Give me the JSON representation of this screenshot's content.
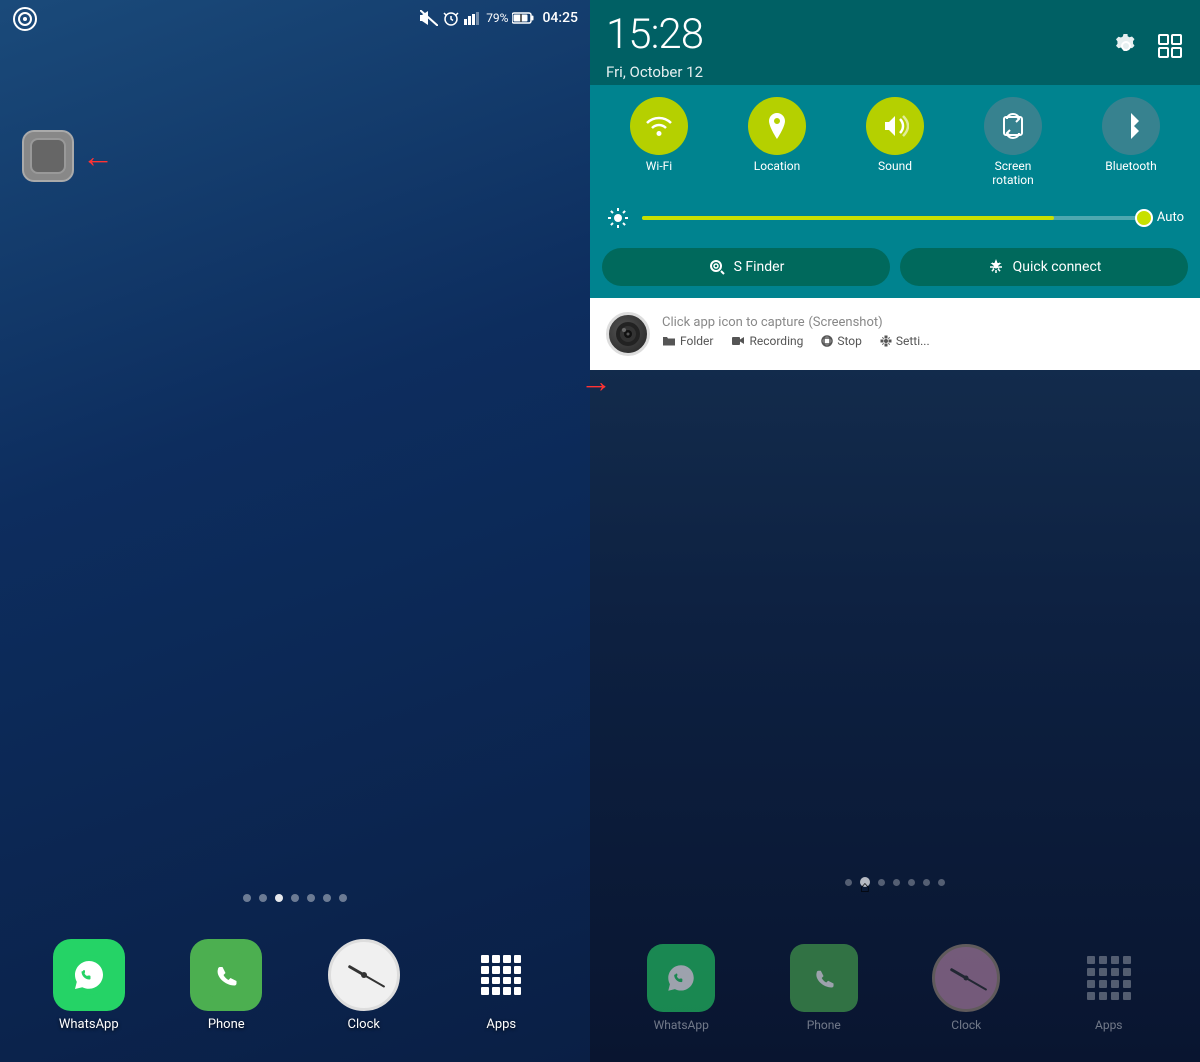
{
  "left": {
    "statusBar": {
      "time": "04:25",
      "battery": "79%",
      "signal": "signal"
    },
    "dock": {
      "apps": [
        {
          "name": "WhatsApp",
          "icon": "whatsapp"
        },
        {
          "name": "Phone",
          "icon": "phone"
        },
        {
          "name": "Clock",
          "icon": "clock"
        },
        {
          "name": "Apps",
          "icon": "apps"
        }
      ]
    },
    "pageDots": 7,
    "activePageDot": 2
  },
  "right": {
    "statusBar": {
      "time": "15:28",
      "date": "Fri, October 12"
    },
    "quickToggles": [
      {
        "id": "wifi",
        "label": "Wi-Fi",
        "active": true,
        "symbol": "wifi"
      },
      {
        "id": "location",
        "label": "Location",
        "active": true,
        "symbol": "location"
      },
      {
        "id": "sound",
        "label": "Sound",
        "active": true,
        "symbol": "sound"
      },
      {
        "id": "rotation",
        "label": "Screen rotation",
        "active": false,
        "symbol": "rotation"
      },
      {
        "id": "bluetooth",
        "label": "Bluetooth",
        "active": false,
        "symbol": "bluetooth"
      }
    ],
    "brightness": {
      "autoLabel": "Auto",
      "fillPercent": 82
    },
    "buttons": [
      {
        "id": "sfinder",
        "label": "S Finder",
        "icon": "search"
      },
      {
        "id": "quickconnect",
        "label": "Quick connect",
        "icon": "asterisk"
      }
    ],
    "notification": {
      "title": "Click app icon to capture",
      "subtitle": "(Screenshot)",
      "actions": [
        {
          "id": "folder",
          "label": "Folder",
          "icon": "folder"
        },
        {
          "id": "recording",
          "label": "Recording",
          "icon": "video"
        },
        {
          "id": "stop",
          "label": "Stop",
          "icon": "stop"
        },
        {
          "id": "settings",
          "label": "Setti...",
          "icon": "gear"
        }
      ]
    },
    "dock": {
      "apps": [
        {
          "name": "WhatsApp",
          "icon": "whatsapp"
        },
        {
          "name": "Phone",
          "icon": "phone"
        },
        {
          "name": "Clock",
          "icon": "clock"
        },
        {
          "name": "Apps",
          "icon": "apps"
        }
      ]
    }
  }
}
